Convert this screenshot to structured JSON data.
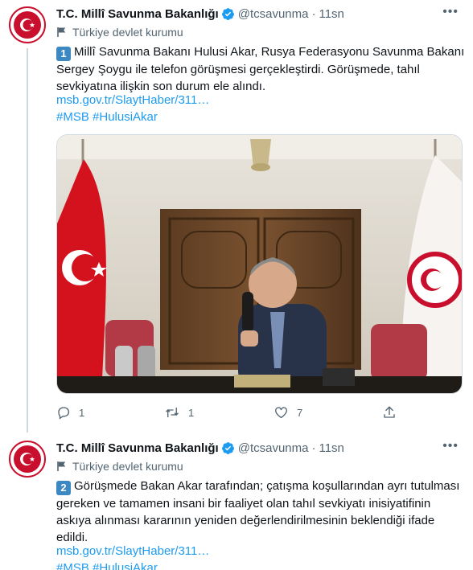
{
  "tweets": [
    {
      "author_name": "T.C. Millî Savunma Bakanlığı",
      "handle": "@tcsavunma",
      "separator": "·",
      "time": "11sn",
      "account_label": "Türkiye devlet kurumu",
      "badge_number": "1",
      "text": "Millî Savunma Bakanı Hulusi Akar, Rusya Federasyonu Savunma Bakanı Sergey Şoygu ile telefon görüşmesi gerçekleştirdi. Görüşmede, tahıl sevkiyatına ilişkin son durum ele alındı.",
      "link": "msb.gov.tr/SlaytHaber/311…",
      "hashtags": "#MSB #HulusiAkar",
      "reply_count": "1",
      "retweet_count": "1",
      "like_count": "7"
    },
    {
      "author_name": "T.C. Millî Savunma Bakanlığı",
      "handle": "@tcsavunma",
      "separator": "·",
      "time": "11sn",
      "account_label": "Türkiye devlet kurumu",
      "badge_number": "2",
      "text": "Görüşmede Bakan Akar tarafından; çatışma koşullarından ayrı tutulması gereken ve tamamen insani bir faaliyet olan tahıl sevkiyatı inisiyatifinin askıya alınması kararının yeniden değerlendirilmesinin beklendiği ifade edildi.",
      "link": "msb.gov.tr/SlaytHaber/311…",
      "hashtags": "#MSB #HulusiAkar"
    }
  ],
  "colors": {
    "link": "#1d9bf0",
    "muted": "#536471",
    "verified": "#1d9bf0",
    "badge": "#3b88c3",
    "brand_red": "#c8102e"
  },
  "icons": [
    "flag-icon",
    "verified-icon",
    "more-icon",
    "reply-icon",
    "retweet-icon",
    "like-icon",
    "share-icon"
  ]
}
